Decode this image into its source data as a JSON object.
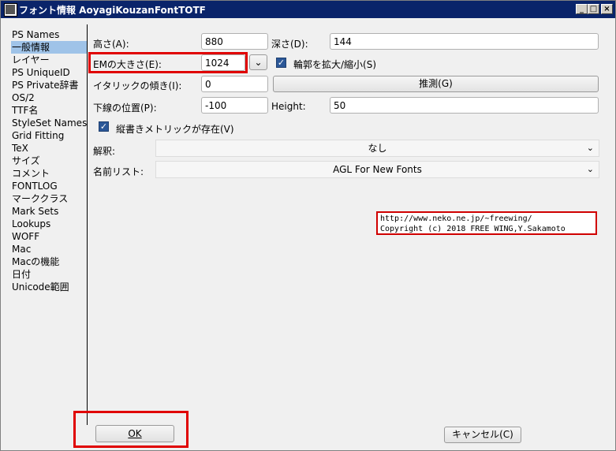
{
  "window": {
    "title": "フォント情報 AoyagiKouzanFontTOTF",
    "minimize": "_",
    "maximize": "□",
    "close": "×"
  },
  "sidebar": {
    "items": [
      {
        "label": "PS Names"
      },
      {
        "label": "一般情報",
        "selected": true
      },
      {
        "label": "レイヤー"
      },
      {
        "label": "PS UniqueID"
      },
      {
        "label": "PS Private辞書"
      },
      {
        "label": "OS/2"
      },
      {
        "label": "TTF名"
      },
      {
        "label": "StyleSet Names"
      },
      {
        "label": "Grid Fitting"
      },
      {
        "label": "TeX"
      },
      {
        "label": "サイズ"
      },
      {
        "label": "コメント"
      },
      {
        "label": "FONTLOG"
      },
      {
        "label": "マーククラス"
      },
      {
        "label": "Mark Sets"
      },
      {
        "label": "Lookups"
      },
      {
        "label": "WOFF"
      },
      {
        "label": "Mac"
      },
      {
        "label": "Macの機能"
      },
      {
        "label": "日付"
      },
      {
        "label": "Unicode範囲"
      }
    ]
  },
  "form": {
    "ascent_label": "高さ(A):",
    "ascent_value": "880",
    "descent_label": "深さ(D):",
    "descent_value": "144",
    "em_label": "EMの大きさ(E):",
    "em_value": "1024",
    "scale_outlines_label": "輪郭を拡大/縮小(S)",
    "italic_label": "イタリックの傾き(I):",
    "italic_value": "0",
    "guess_button": "推測(G)",
    "underline_label": "下線の位置(P):",
    "underline_value": "-100",
    "height_label": "Height:",
    "height_value": "50",
    "vertical_metrics_label": "縦書きメトリックが存在(V)",
    "interpretation_label": "解釈:",
    "interpretation_value": "なし",
    "namelist_label": "名前リスト:",
    "namelist_value": "AGL For New Fonts"
  },
  "credit": {
    "line1": "http://www.neko.ne.jp/~freewing/",
    "line2": "Copyright (c) 2018 FREE WING,Y.Sakamoto"
  },
  "footer": {
    "ok_button": "OK",
    "cancel_button": "キャンセル(C)"
  },
  "colors": {
    "titlebar": "#0a246a",
    "selected_item": "#9fc3e8",
    "highlight_red": "#e00000",
    "checkbox": "#2b5797"
  }
}
